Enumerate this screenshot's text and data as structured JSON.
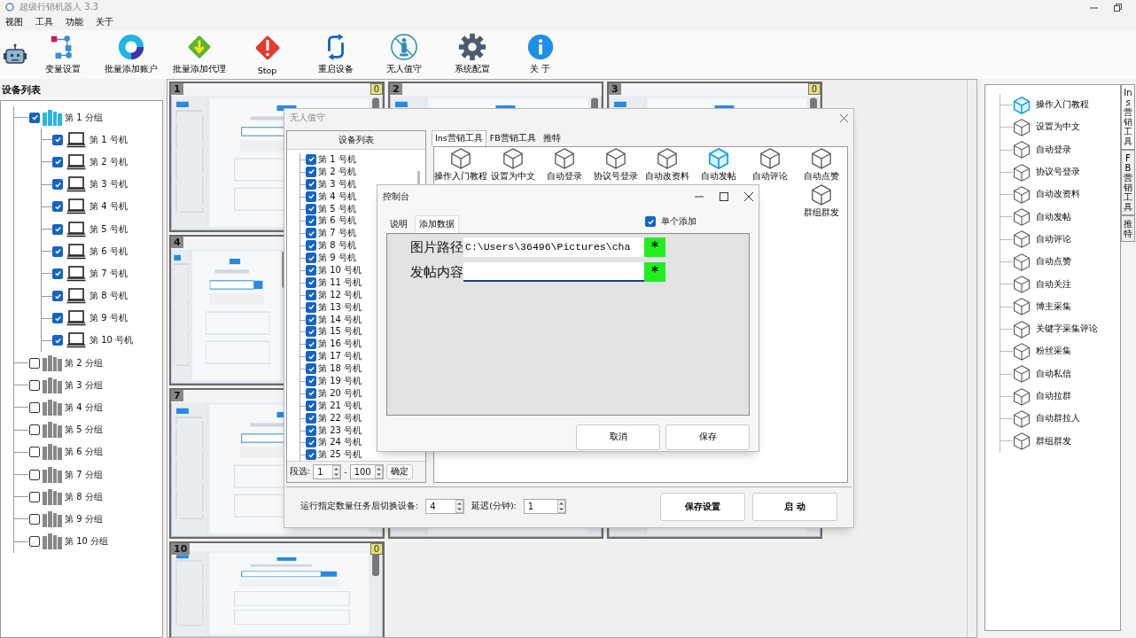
{
  "window": {
    "title": "超级行销机器人 3.3"
  },
  "menu": [
    "视图",
    "工具",
    "功能",
    "关于"
  ],
  "toolbar": [
    {
      "kind": "robot"
    },
    {
      "kind": "variables",
      "label": "变量设置"
    },
    {
      "kind": "accounts",
      "label": "批量添加账户"
    },
    {
      "kind": "proxies",
      "label": "批量添加代理"
    },
    {
      "kind": "stop",
      "label": "Stop"
    },
    {
      "kind": "restart",
      "label": "重启设备"
    },
    {
      "kind": "unattended",
      "label": "无人值守"
    },
    {
      "kind": "settings",
      "label": "系统配置"
    },
    {
      "kind": "about",
      "label": "关 于"
    }
  ],
  "device_panel": {
    "title": "设备列表",
    "groups": [
      {
        "label": "第 1 分组",
        "checked": true,
        "children": [
          {
            "label": "第 1 号机",
            "checked": true
          },
          {
            "label": "第 2 号机",
            "checked": true
          },
          {
            "label": "第 3 号机",
            "checked": true
          },
          {
            "label": "第 4 号机",
            "checked": true
          },
          {
            "label": "第 5 号机",
            "checked": true
          },
          {
            "label": "第 6 号机",
            "checked": true
          },
          {
            "label": "第 7 号机",
            "checked": true
          },
          {
            "label": "第 8 号机",
            "checked": true
          },
          {
            "label": "第 9 号机",
            "checked": true
          },
          {
            "label": "第 10 号机",
            "checked": true
          }
        ]
      },
      {
        "label": "第 2 分组",
        "checked": false
      },
      {
        "label": "第 3 分组",
        "checked": false
      },
      {
        "label": "第 4 分组",
        "checked": false
      },
      {
        "label": "第 5 分组",
        "checked": false
      },
      {
        "label": "第 6 分组",
        "checked": false
      },
      {
        "label": "第 7 分组",
        "checked": false
      },
      {
        "label": "第 8 分组",
        "checked": false
      },
      {
        "label": "第 9 分组",
        "checked": false
      },
      {
        "label": "第 10 分组",
        "checked": false
      }
    ]
  },
  "screens": [
    {
      "kind": "picture",
      "number": "1",
      "badge": "0"
    },
    {
      "kind": "picture",
      "number": "2"
    },
    {
      "kind": "picture",
      "number": "3",
      "badge": "0"
    },
    {
      "kind": "picture",
      "number": "4"
    },
    {
      "kind": "covered"
    },
    {
      "kind": "covered"
    },
    {
      "kind": "picture",
      "number": "7"
    },
    {
      "kind": "picture"
    },
    {
      "kind": "picture"
    },
    {
      "kind": "picture",
      "number": "10",
      "badge": "0"
    }
  ],
  "tools_panel": {
    "tabs": [
      {
        "label": "Ins营销工具",
        "selected": true
      },
      {
        "label": "FB营销工具",
        "selected": false
      },
      {
        "label": "推特",
        "selected": false
      }
    ],
    "items": [
      {
        "label": "操作入门教程",
        "selected": true
      },
      {
        "label": "设置为中文",
        "selected": false
      },
      {
        "label": "自动登录",
        "selected": false
      },
      {
        "label": "协议号登录",
        "selected": false
      },
      {
        "label": "自动改资料",
        "selected": false
      },
      {
        "label": "自动发帖",
        "selected": false
      },
      {
        "label": "自动评论",
        "selected": false
      },
      {
        "label": "自动点赞",
        "selected": false
      },
      {
        "label": "自动关注",
        "selected": false
      },
      {
        "label": "博主采集",
        "selected": false
      },
      {
        "label": "关键字采集评论",
        "selected": false
      },
      {
        "label": "粉丝采集",
        "selected": false
      },
      {
        "label": "自动私信",
        "selected": false
      },
      {
        "label": "自动拉群",
        "selected": false
      },
      {
        "label": "自动群拉人",
        "selected": false
      },
      {
        "label": "群组群发",
        "selected": false
      }
    ]
  },
  "unattended_dialog": {
    "title": "无人值守",
    "list_title": "设备列表",
    "devices": [
      {
        "label": "第 1 号机",
        "checked": true
      },
      {
        "label": "第 2 号机",
        "checked": true
      },
      {
        "label": "第 3 号机",
        "checked": true
      },
      {
        "label": "第 4 号机",
        "checked": true
      },
      {
        "label": "第 5 号机",
        "checked": true
      },
      {
        "label": "第 6 号机",
        "checked": true
      },
      {
        "label": "第 7 号机",
        "checked": true
      },
      {
        "label": "第 8 号机",
        "checked": true
      },
      {
        "label": "第 9 号机",
        "checked": true
      },
      {
        "label": "第 10 号机",
        "checked": true
      },
      {
        "label": "第 11 号机",
        "checked": true
      },
      {
        "label": "第 12 号机",
        "checked": true
      },
      {
        "label": "第 13 号机",
        "checked": true
      },
      {
        "label": "第 14 号机",
        "checked": true
      },
      {
        "label": "第 15 号机",
        "checked": true
      },
      {
        "label": "第 16 号机",
        "checked": true
      },
      {
        "label": "第 17 号机",
        "checked": true
      },
      {
        "label": "第 18 号机",
        "checked": true
      },
      {
        "label": "第 19 号机",
        "checked": true
      },
      {
        "label": "第 20 号机",
        "checked": true
      },
      {
        "label": "第 21 号机",
        "checked": true
      },
      {
        "label": "第 22 号机",
        "checked": true
      },
      {
        "label": "第 23 号机",
        "checked": true
      },
      {
        "label": "第 24 号机",
        "checked": true
      },
      {
        "label": "第 25 号机",
        "checked": true
      }
    ],
    "range": {
      "label": "段选:",
      "from": "1",
      "separator": "-",
      "to": "100",
      "button": "确定"
    },
    "tabs": [
      {
        "label": "Ins营销工具",
        "selected": true
      },
      {
        "label": "FB营销工具",
        "selected": false
      },
      {
        "label": "推特",
        "selected": false
      }
    ],
    "tools": [
      {
        "label": "操作入门教程",
        "selected": false
      },
      {
        "label": "设置为中文",
        "selected": false
      },
      {
        "label": "自动登录",
        "selected": false
      },
      {
        "label": "协议号登录",
        "selected": false
      },
      {
        "label": "自动改资料",
        "selected": false
      },
      {
        "label": "自动发帖",
        "selected": true
      },
      {
        "label": "自动评论",
        "selected": false
      },
      {
        "label": "自动点赞",
        "selected": false
      },
      {
        "label": "群组群发",
        "selected": false
      }
    ],
    "switch_label": "运行指定数量任务后切换设备:",
    "switch_value": "4",
    "delay_label": "延迟(分钟):",
    "delay_value": "1",
    "buttons": [
      "保存设置",
      "启 动"
    ]
  },
  "console_dialog": {
    "title": "控制台",
    "tabs": [
      {
        "label": "说明",
        "selected": false
      },
      {
        "label": "添加数据",
        "selected": true
      }
    ],
    "single_add": {
      "label": "单个添加",
      "checked": true
    },
    "fields": [
      {
        "label": "图片路径",
        "value": "C:\\Users\\36496\\Pictures\\cha",
        "marker": "*",
        "focused": false
      },
      {
        "label": "发帖内容",
        "marker": "*",
        "focused": true
      }
    ],
    "buttons": [
      "取消",
      "保存"
    ]
  }
}
